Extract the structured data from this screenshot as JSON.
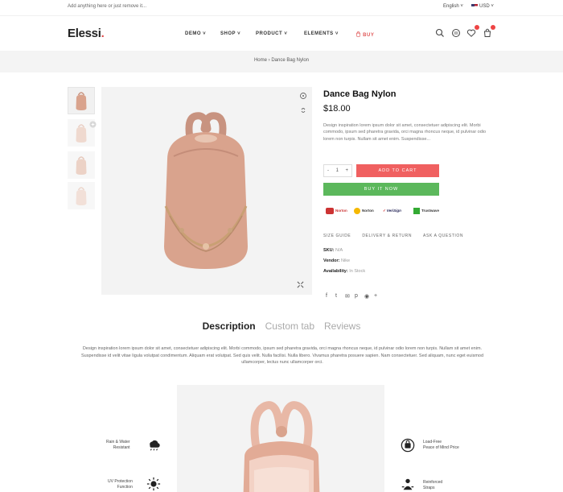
{
  "topbar": {
    "promo": "Add anything here or just remove it...",
    "language": "English",
    "currency": "USD"
  },
  "header": {
    "logo_main": "Elessi",
    "logo_dot": ".",
    "nav": [
      "DEMO",
      "SHOP",
      "PRODUCT",
      "ELEMENTS"
    ],
    "buy_label": "BUY",
    "icons": [
      "search-icon",
      "compare-icon",
      "wishlist-icon",
      "cart-icon"
    ]
  },
  "breadcrumb": {
    "home": "Home",
    "sep": "›",
    "current": "Dance Bag Nylon"
  },
  "product": {
    "title": "Dance Bag Nylon",
    "price": "$18.00",
    "description": "Design inspiration lorem ipsum dolor sit amet, consectetuer adipiscing elit. Morbi commodo, ipsum sed pharetra gravida, orci magna rhoncus neque, id pulvinar odio lorem non turpis. Nullam sit amet enim. Suspendisse...",
    "qty_minus": "-",
    "qty_value": "1",
    "qty_plus": "+",
    "add_to_cart": "ADD TO CART",
    "buy_now": "BUY IT NOW",
    "trust_badges": [
      "Norton",
      "Norton",
      "VeriSign",
      "Trustwave"
    ],
    "links": [
      "SIZE GUIDE",
      "DELIVERY & RETURN",
      "ASK A QUESTION"
    ],
    "sku_label": "SKU:",
    "sku_value": "N/A",
    "vendor_label": "Vendor:",
    "vendor_value": "Nike",
    "availability_label": "Availability:",
    "availability_value": "In Stock",
    "social": [
      "f",
      "t",
      "✉",
      "p",
      "◉",
      "+"
    ]
  },
  "tabs": {
    "items": [
      "Description",
      "Custom tab",
      "Reviews"
    ],
    "active": "Description",
    "body": "Design inspiration lorem ipsum dolor sit amet, consectetuer adipiscing elit. Morbi commodo, ipsum sed pharetra gravida, orci magna rhoncus neque, id pulvinar odio lorem non turpis. Nullam sit amet enim. Suspendisse id velit vitae ligula volutpat condimentum. Aliquam erat volutpat. Sed quis velit. Nulla facilisi. Nulla libero. Vivamus pharetra posuere sapien. Nam consectetuer. Sed aliquam, nunc eget euismod ullamcorper, lectus nunc ullamcorper orci."
  },
  "features": {
    "left_1": "Rain & Water\nResistant",
    "left_2": "UV Protection\nFunction",
    "right_1": "Load-Free\nPeace of Mind Price",
    "right_2": "Reinforced\nStraps"
  },
  "colors": {
    "accent_red": "#f06060",
    "buy_green": "#5cb85c",
    "bag_pink": "#d9a38d"
  }
}
